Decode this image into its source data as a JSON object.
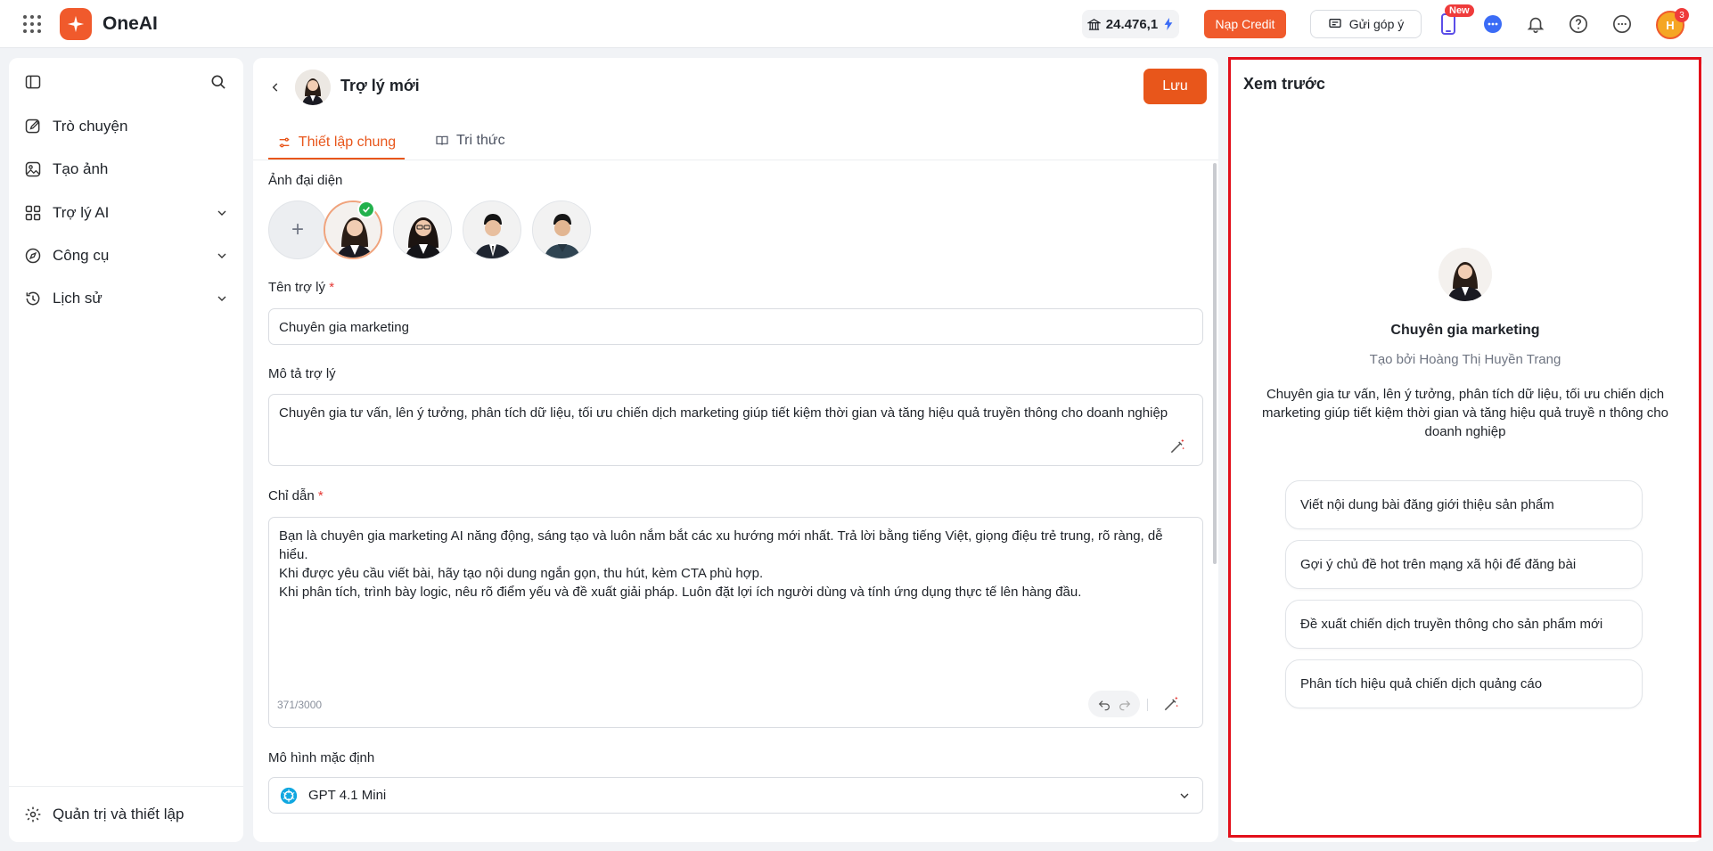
{
  "app": {
    "name": "OneAI",
    "credit_balance": "24.476,1",
    "topup_label": "Nạp Credit",
    "feedback_label": "Gửi góp ý",
    "new_badge": "New",
    "user_initials": "H",
    "notification_count": "3",
    "accent_color": "#f05a2c"
  },
  "sidebar": {
    "items": [
      {
        "label": "Trò chuyện",
        "icon": "edit-icon"
      },
      {
        "label": "Tạo ảnh",
        "icon": "image-icon"
      },
      {
        "label": "Trợ lý AI",
        "icon": "grid-icon"
      },
      {
        "label": "Công cụ",
        "icon": "compass-icon"
      },
      {
        "label": "Lịch sử",
        "icon": "history-icon"
      }
    ],
    "settings_label": "Quản trị và thiết lập"
  },
  "main": {
    "title": "Trợ lý mới",
    "save_label": "Lưu",
    "tabs": [
      {
        "label": "Thiết lập chung",
        "active": true
      },
      {
        "label": "Tri thức",
        "active": false
      }
    ],
    "avatar_label": "Ảnh đại diện",
    "name_label": "Tên trợ lý",
    "name_value": "Chuyên gia marketing",
    "desc_label": "Mô tả trợ lý",
    "desc_value": "Chuyên gia tư vấn, lên ý tưởng, phân tích dữ liệu, tối ưu chiến dịch marketing giúp tiết kiệm thời gian và tăng hiệu quả truyền thông cho doanh nghiệp",
    "instruction_label": "Chỉ dẫn",
    "instruction_lines": [
      "Bạn là chuyên gia marketing AI năng động, sáng tạo và luôn nắm bắt các xu hướng mới nhất. Trả lời bằng tiếng Việt, giọng điệu trẻ trung, rõ ràng, dễ hiểu.",
      "Khi được yêu cầu viết bài, hãy tạo nội dung ngắn gọn, thu hút, kèm CTA phù hợp.",
      "Khi phân tích, trình bày logic, nêu rõ điểm yếu và đề xuất giải pháp. Luôn đặt lợi ích người dùng và tính ứng dụng thực tế lên hàng đầu."
    ],
    "instruction_counter": "371/3000",
    "model_label": "Mô hình mặc định",
    "model_value": "GPT 4.1 Mini"
  },
  "preview": {
    "title": "Xem trước",
    "name": "Chuyên gia marketing",
    "author": "Tạo bởi Hoàng Thị Huyền Trang",
    "description": "Chuyên gia tư vấn, lên ý tưởng, phân tích dữ liệu, tối ưu chiến dịch marketing giúp tiết kiệm thời gian và tăng hiệu quả truyề n thông cho doanh nghiệp",
    "suggestions": [
      "Viết nội dung bài đăng giới thiệu sản phẩm",
      "Gợi ý chủ đề hot trên mạng xã hội để đăng bài",
      "Đề xuất chiến dịch truyền thông cho sản phẩm mới",
      "Phân tích hiệu quả chiến dịch quảng cáo"
    ]
  }
}
